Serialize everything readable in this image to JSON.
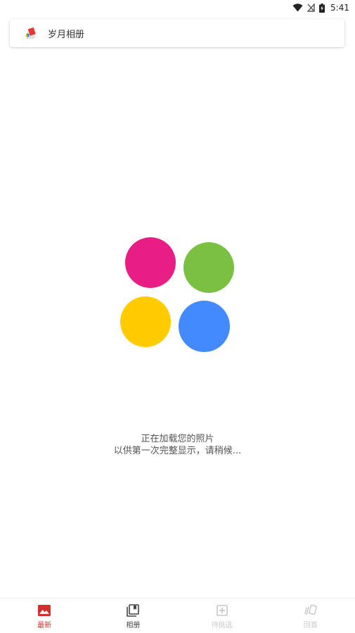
{
  "status_bar": {
    "time": "5:41"
  },
  "header": {
    "title": "岁月相册"
  },
  "loader": {
    "colors": [
      "#e91e84",
      "#7bc043",
      "#ffcc00",
      "#448aff"
    ]
  },
  "loading": {
    "line1": "正在加载您的照片",
    "line2": "以供第一次完整显示，请稍候..."
  },
  "bottom_nav": {
    "items": [
      {
        "label": "最新",
        "icon": "image-icon",
        "active": true
      },
      {
        "label": "相册",
        "icon": "album-icon",
        "active": false
      },
      {
        "label": "待挑选",
        "icon": "add-box-icon",
        "active": false
      },
      {
        "label": "回首",
        "icon": "cards-icon",
        "active": false
      }
    ],
    "active_color": "#d32f2f",
    "normal_color": "#444444",
    "disabled_color": "#c8c8c8"
  }
}
